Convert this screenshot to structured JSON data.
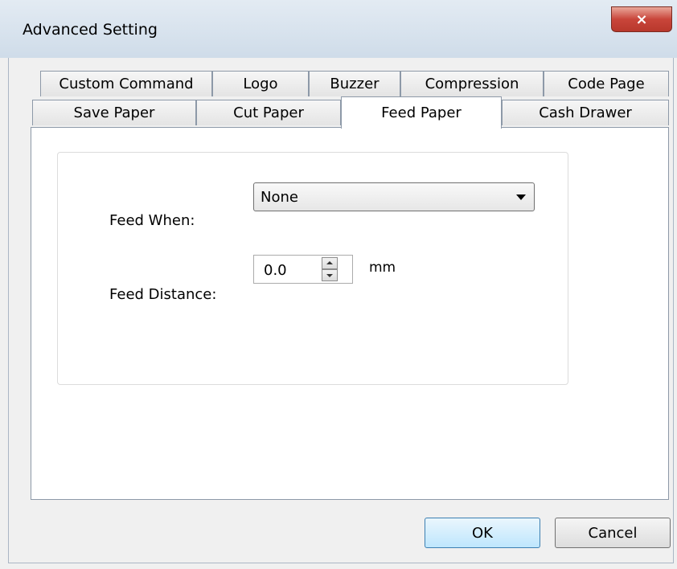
{
  "window": {
    "title": "Advanced Setting",
    "close_icon": "×"
  },
  "tabs_row1": [
    "Custom Command",
    "Logo",
    "Buzzer",
    "Compression",
    "Code Page"
  ],
  "tabs_row2": [
    "Save Paper",
    "Cut Paper",
    "Feed Paper",
    "Cash Drawer"
  ],
  "active_tab": "Feed Paper",
  "feed_paper": {
    "feed_when_label": "Feed When:",
    "feed_when_value": "None",
    "feed_distance_label": "Feed Distance:",
    "feed_distance_value": "0.0",
    "feed_distance_unit": "mm"
  },
  "buttons": {
    "ok": "OK",
    "cancel": "Cancel"
  }
}
